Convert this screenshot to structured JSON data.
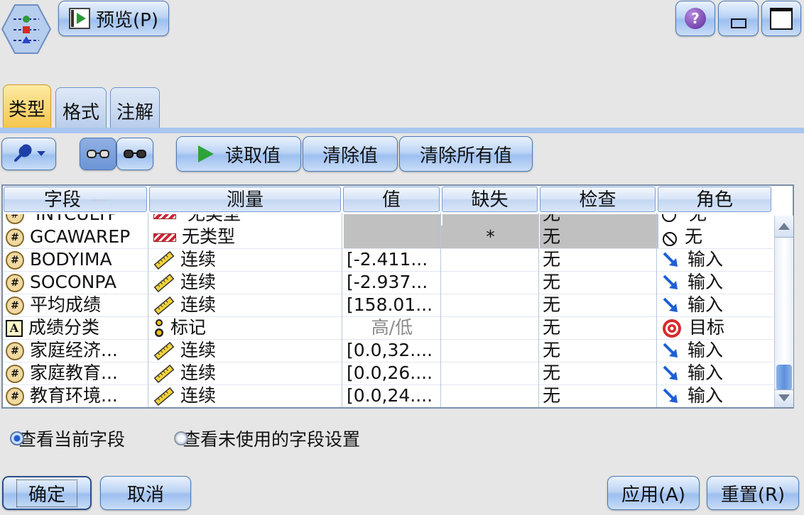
{
  "toolbar": {
    "preview_label": "预览(P)",
    "help_symbol": "?"
  },
  "tabs": [
    {
      "label": "类型",
      "active": true
    },
    {
      "label": "格式",
      "active": false
    },
    {
      "label": "注解",
      "active": false
    }
  ],
  "actions": {
    "read_values": "读取值",
    "clear_values": "清除值",
    "clear_all_values": "清除所有值"
  },
  "table": {
    "columns": [
      "字段",
      "测量",
      "值",
      "缺失",
      "检查",
      "角色"
    ],
    "partial_row": {
      "field": "INTCULTP",
      "measure": "无类型",
      "check": "无",
      "role": "无"
    },
    "rows": [
      {
        "field": "GCAWAREP",
        "field_icon": "set-icon",
        "measure": "无类型",
        "measure_icon": "typeless-icon",
        "value": "",
        "missing": "*",
        "check": "无",
        "role": "无",
        "role_icon": "none-role-icon",
        "shaded": true
      },
      {
        "field": "BODYIMA",
        "field_icon": "set-icon",
        "measure": "连续",
        "measure_icon": "ruler-icon",
        "value": "[-2.411...",
        "missing": "",
        "check": "无",
        "role": "输入",
        "role_icon": "input-arrow-icon",
        "shaded": false
      },
      {
        "field": "SOCONPA",
        "field_icon": "set-icon",
        "measure": "连续",
        "measure_icon": "ruler-icon",
        "value": "[-2.937...",
        "missing": "",
        "check": "无",
        "role": "输入",
        "role_icon": "input-arrow-icon",
        "shaded": false
      },
      {
        "field": "平均成绩",
        "field_icon": "set-icon",
        "measure": "连续",
        "measure_icon": "ruler-icon",
        "value": "[158.01...",
        "missing": "",
        "check": "无",
        "role": "输入",
        "role_icon": "input-arrow-icon",
        "shaded": false
      },
      {
        "field": "成绩分类",
        "field_icon": "string-icon",
        "measure": "标记",
        "measure_icon": "flag-icon",
        "value": "高/低",
        "missing": "",
        "check": "无",
        "role": "目标",
        "role_icon": "target-icon",
        "shaded": false
      },
      {
        "field": "家庭经济...",
        "field_icon": "set-icon",
        "measure": "连续",
        "measure_icon": "ruler-icon",
        "value": "[0.0,32....",
        "missing": "",
        "check": "无",
        "role": "输入",
        "role_icon": "input-arrow-icon",
        "shaded": false
      },
      {
        "field": "家庭教育...",
        "field_icon": "set-icon",
        "measure": "连续",
        "measure_icon": "ruler-icon",
        "value": "[0.0,26....",
        "missing": "",
        "check": "无",
        "role": "输入",
        "role_icon": "input-arrow-icon",
        "shaded": false
      },
      {
        "field": "教育环境...",
        "field_icon": "set-icon",
        "measure": "连续",
        "measure_icon": "ruler-icon",
        "value": "[0.0,24....",
        "missing": "",
        "check": "无",
        "role": "输入",
        "role_icon": "input-arrow-icon",
        "shaded": false
      }
    ]
  },
  "view_options": {
    "current_fields": "查看当前字段",
    "unused_fields": "查看未使用的字段设置",
    "selected": "current_fields"
  },
  "buttons": {
    "ok": "确定",
    "cancel": "取消",
    "apply": "应用(A)",
    "reset": "重置(R)"
  },
  "colors": {
    "accent_blue": "#a9c6f0",
    "active_tab": "#f6c54e",
    "shaded_cell": "#c0c0c0"
  }
}
